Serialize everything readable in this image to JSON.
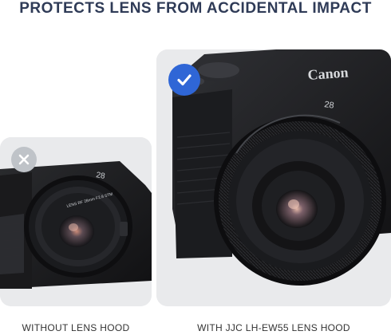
{
  "headline": "PROTECTS LENS FROM ACCIDENTAL IMPACT",
  "left_panel": {
    "caption": "WITHOUT LENS HOOD",
    "badge_icon": "x-icon",
    "badge_color": "#bfc3c8",
    "lens_focal_mark": "28"
  },
  "right_panel": {
    "caption": "WITH JJC LH-EW55 LENS HOOD",
    "badge_icon": "check-icon",
    "badge_color": "#2f66d6",
    "camera_brand": "Canon",
    "lens_focal_mark": "28"
  },
  "colors": {
    "headline": "#2f3b57",
    "card_background": "#e9eaec",
    "camera_body": "#1c1d1f"
  }
}
